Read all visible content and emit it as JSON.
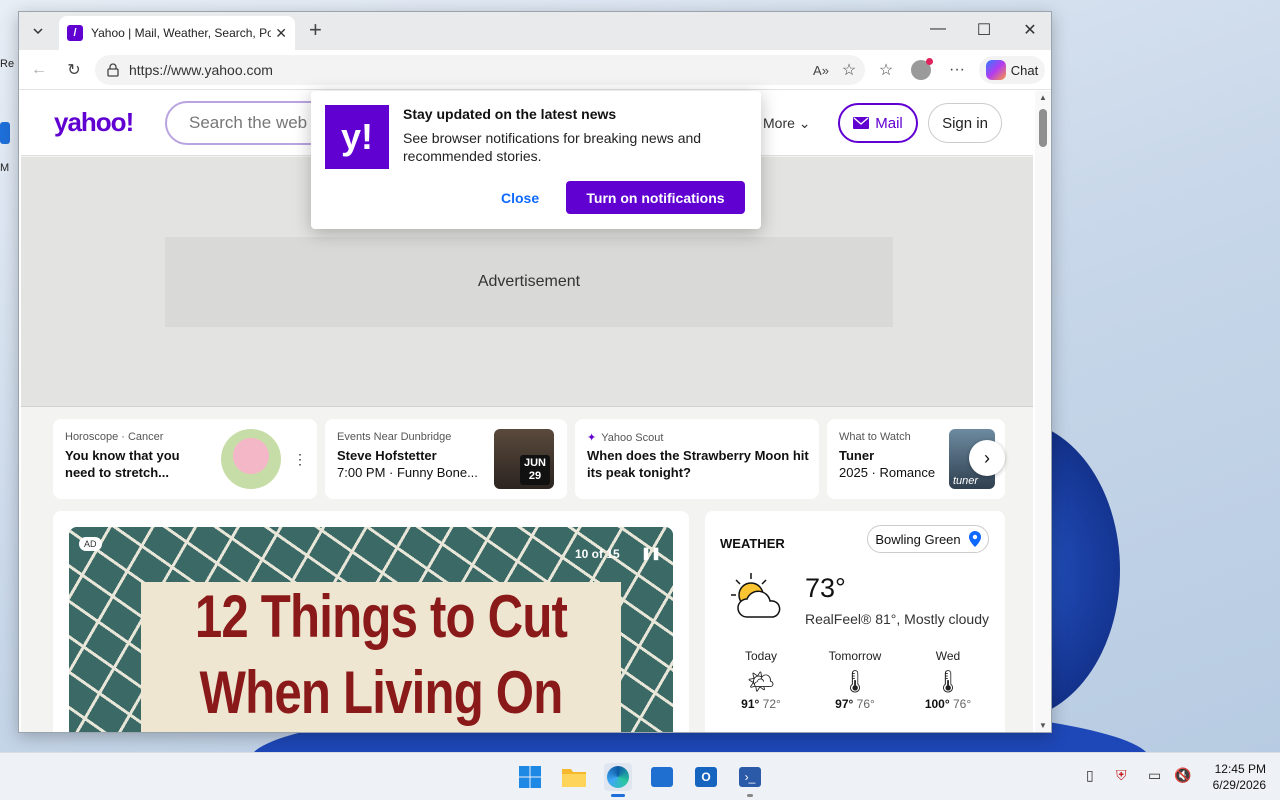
{
  "desktop": {
    "icon_a": "Re",
    "icon_b": "M"
  },
  "browser": {
    "tab_title": "Yahoo | Mail, Weather, Search, Politics",
    "url": "https://www.yahoo.com",
    "chat_label": "Chat"
  },
  "yahoo": {
    "logo": "yahoo!",
    "search_placeholder": "Search the web",
    "more_label": "More",
    "mail_label": "Mail",
    "signin_label": "Sign in",
    "ad_label": "Advertisement"
  },
  "popup": {
    "logo": "y!",
    "title": "Stay updated on the latest news",
    "body": "See browser notifications for breaking news and recommended stories.",
    "close_label": "Close",
    "turn_on_label": "Turn on notifications"
  },
  "cards": [
    {
      "category": "Horoscope · Cancer",
      "title": "You know that you need to stretch...",
      "sub": ""
    },
    {
      "category": "Events Near Dunbridge",
      "title": "Steve Hofstetter",
      "sub": "7:00 PM · Funny Bone...",
      "badge_month": "JUN",
      "badge_day": "29"
    },
    {
      "category": "Yahoo Scout",
      "title": "When does the Strawberry Moon hit its peak tonight?",
      "sub": ""
    },
    {
      "category": "What to Watch",
      "title": "Tuner",
      "sub": "2025 · Romance",
      "thumb_text": "tuner"
    }
  ],
  "slideshow": {
    "ad_tag": "AD",
    "counter": "10 of 15",
    "line1": "12 Things to Cut",
    "line2": "When Living On"
  },
  "weather": {
    "heading": "WEATHER",
    "location": "Bowling Green",
    "temp": "73°",
    "realfeel": "RealFeel® 81°, Mostly cloudy",
    "forecast": [
      {
        "day": "Today",
        "hi": "91°",
        "lo": "72°"
      },
      {
        "day": "Tomorrow",
        "hi": "97°",
        "lo": "76°"
      },
      {
        "day": "Wed",
        "hi": "100°",
        "lo": "76°"
      }
    ]
  },
  "taskbar": {
    "time": "12:45 PM",
    "date": "6/29/2026"
  }
}
